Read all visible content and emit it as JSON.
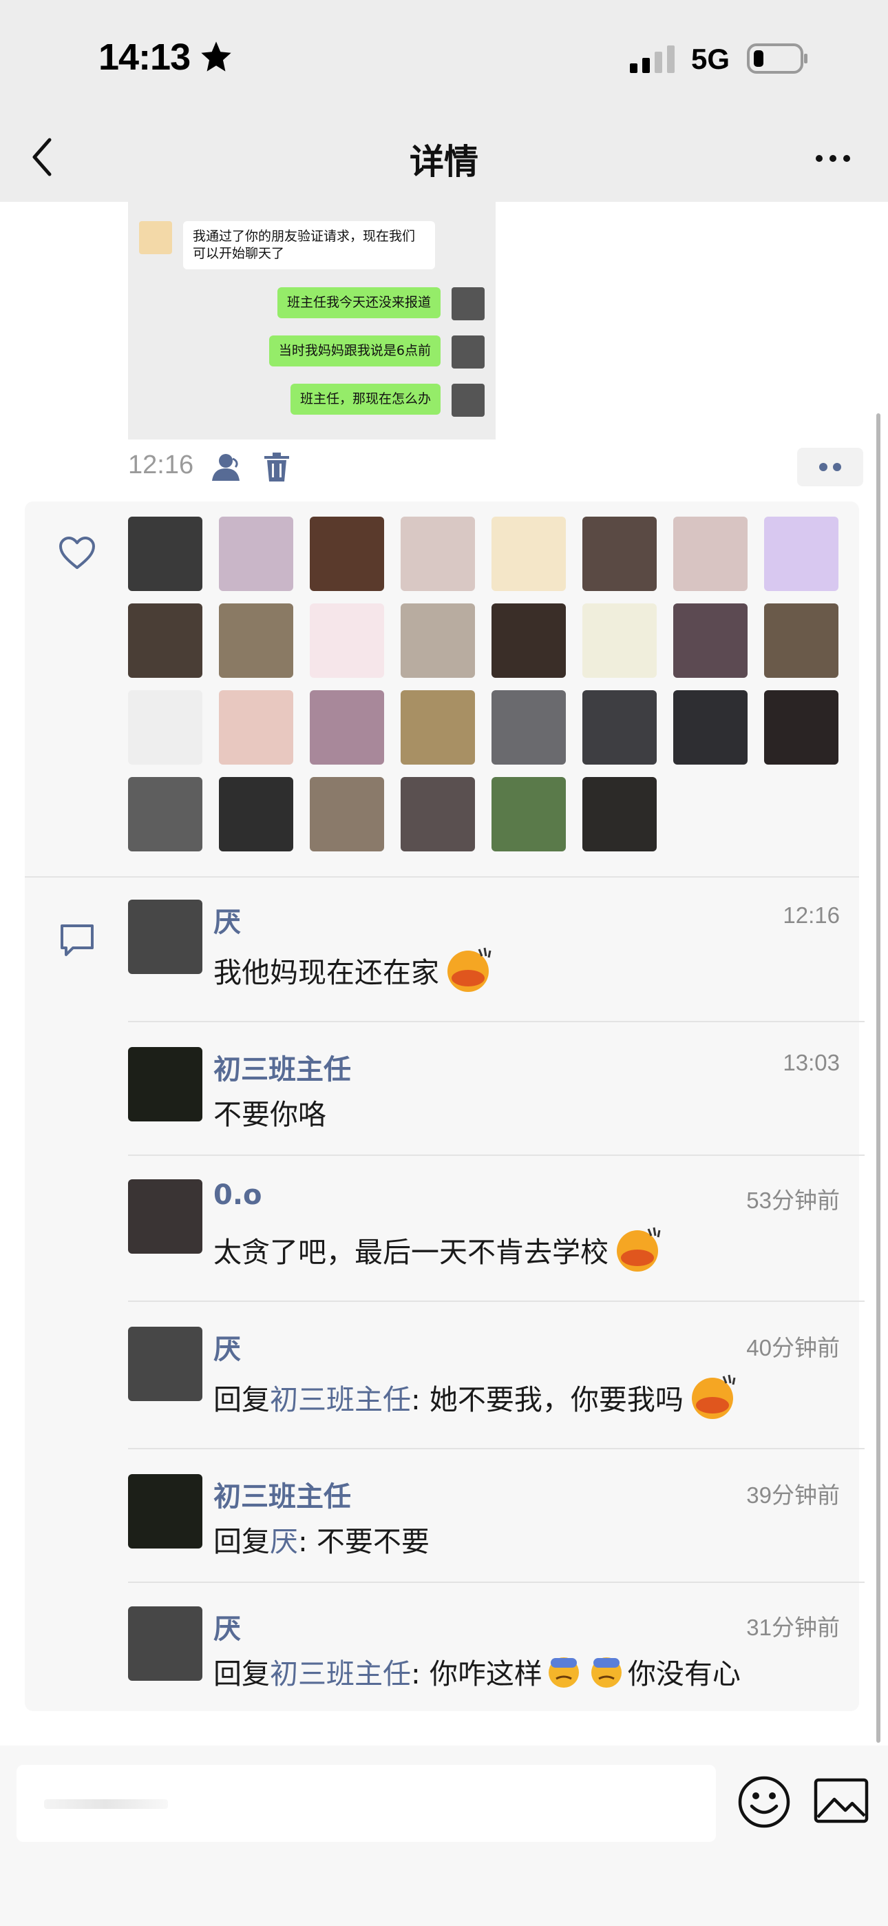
{
  "status_bar": {
    "time": "14:13",
    "network": "5G",
    "icons": [
      "star-icon",
      "signal-icon",
      "battery-icon"
    ]
  },
  "nav": {
    "title": "详情",
    "back_icon": "chevron-left-icon",
    "more_icon": "more-dots-icon"
  },
  "post": {
    "chat_screenshot": {
      "messages": [
        {
          "side": "left",
          "text": "我通过了你的朋友验证请求，现在我们可以开始聊天了"
        },
        {
          "side": "right",
          "text": "班主任我今天还没来报道"
        },
        {
          "side": "right",
          "text": "当时我妈妈跟我说是6点前"
        },
        {
          "side": "right",
          "text": "班主任，那现在怎么办"
        }
      ]
    },
    "time": "12:16",
    "icons": [
      "person-visibility-icon",
      "trash-icon",
      "more-dots-icon"
    ]
  },
  "likes": {
    "icon": "heart-icon",
    "avatars": [
      "#3a3a3a",
      "#c9b6c8",
      "#5a3a2c",
      "#d9c8c4",
      "#f4e6c8",
      "#5a4a44",
      "#d8c4c2",
      "#d8c8f0",
      "#4a3e36",
      "#8a7a64",
      "#f6e6ea",
      "#b8aca0",
      "#3a2e28",
      "#f0eedc",
      "#5c4a52",
      "#6a5a4a",
      "#eeeeee",
      "#e8c8c0",
      "#a8889a",
      "#a89064",
      "#6a6a6e",
      "#3e3e42",
      "#2e2e32",
      "#2a2424",
      "#5e5e5e",
      "#2e2e2e",
      "#8a7a6a",
      "#5a5050",
      "#5a7a4a",
      "#2c2a28"
    ]
  },
  "comments": {
    "icon": "comment-icon",
    "items": [
      {
        "name": "厌",
        "time": "12:16",
        "reply_prefix": "",
        "reply_to": "",
        "text": "我他妈现在还在家",
        "emoji": "pouting-emoji-icon",
        "avatar": "#474747"
      },
      {
        "name": "初三班主任",
        "time": "13:03",
        "reply_prefix": "",
        "reply_to": "",
        "text": "不要你咯",
        "emoji": "",
        "avatar": "#1c1f18"
      },
      {
        "name": "0.o",
        "time": "53分钟前",
        "reply_prefix": "",
        "reply_to": "",
        "text": "太贪了吧，最后一天不肯去学校",
        "emoji": "pouting-emoji-icon",
        "avatar": "#3a3434"
      },
      {
        "name": "厌",
        "time": "40分钟前",
        "reply_prefix": "回复",
        "reply_to": "初三班主任",
        "text": ": 她不要我，你要我吗",
        "emoji": "pouting-emoji-icon",
        "avatar": "#474747"
      },
      {
        "name": "初三班主任",
        "time": "39分钟前",
        "reply_prefix": "回复",
        "reply_to": "厌",
        "text": ": 不要不要",
        "emoji": "",
        "avatar": "#1c1f18"
      },
      {
        "name": "厌",
        "time": "31分钟前",
        "reply_prefix": "回复",
        "reply_to": "初三班主任",
        "text": ": 你咋这样",
        "text_after": "你没有心",
        "emoji": "sweat-emoji-icon",
        "avatar": "#474747"
      }
    ]
  },
  "bottom": {
    "input_placeholder": "",
    "emoji_icon": "smile-icon",
    "image_icon": "image-icon"
  }
}
